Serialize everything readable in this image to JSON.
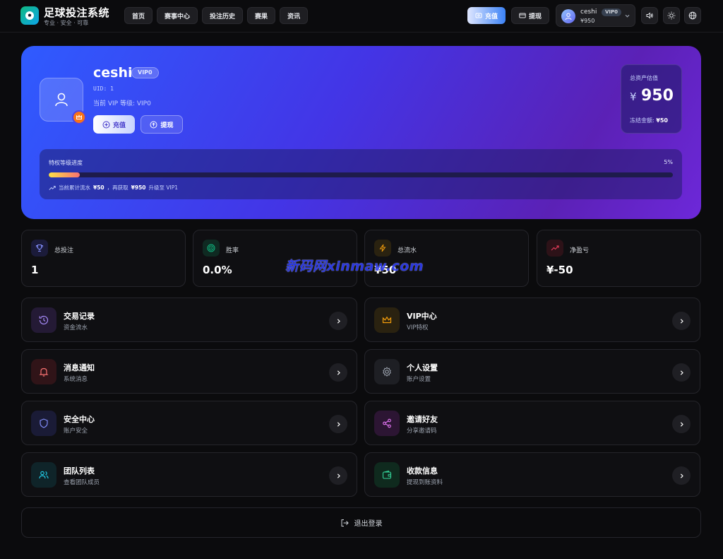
{
  "brand": {
    "title": "足球投注系统",
    "subtitle": "专业 · 安全 · 可靠"
  },
  "nav": {
    "items": [
      "首页",
      "赛事中心",
      "投注历史",
      "赛果",
      "资讯"
    ]
  },
  "top_actions": {
    "recharge": "充值",
    "withdraw": "提现"
  },
  "user_chip": {
    "name": "ceshi",
    "vip": "VIP0",
    "balance": "¥950"
  },
  "hero": {
    "name": "ceshi",
    "vip_badge": "VIP0",
    "uid": "UID: 1",
    "level": "当前 VIP 等级: VIP0",
    "recharge": "充值",
    "withdraw": "提现",
    "asset_label": "总资产估值",
    "asset_currency": "¥",
    "asset_value": "950",
    "frozen_label": "冻结金额:",
    "frozen_value": "¥50",
    "progress_title": "特权等级进度",
    "progress_pct_text": "5%",
    "progress_value": 5,
    "note_prefix": "当前累计流水",
    "note_flow": "¥50",
    "note_mid": "，再获取",
    "note_need": "¥950",
    "note_suffix": "升级至 VIP1"
  },
  "stats": [
    {
      "label": "总投注",
      "value": "1"
    },
    {
      "label": "胜率",
      "value": "0.0%"
    },
    {
      "label": "总流水",
      "value": "¥50"
    },
    {
      "label": "净盈亏",
      "value": "¥-50"
    }
  ],
  "menu": [
    {
      "title": "交易记录",
      "subtitle": "资金流水"
    },
    {
      "title": "VIP中心",
      "subtitle": "VIP特权"
    },
    {
      "title": "消息通知",
      "subtitle": "系统消息"
    },
    {
      "title": "个人设置",
      "subtitle": "账户设置"
    },
    {
      "title": "安全中心",
      "subtitle": "账户安全"
    },
    {
      "title": "邀请好友",
      "subtitle": "分享邀请码"
    },
    {
      "title": "团队列表",
      "subtitle": "查看团队成员"
    },
    {
      "title": "收款信息",
      "subtitle": "提现到账资料"
    }
  ],
  "logout": "退出登录",
  "watermark": "新码网xinmaw.com",
  "colors": {
    "background": "#0b0b0d",
    "card": "#0f0f12",
    "hero_start": "#2f5bff",
    "hero_end": "#6d28d9",
    "accent_orange": "#f97316"
  },
  "icons": {
    "logo": "soccer-ball-icon",
    "volume": "volume-icon",
    "theme": "sun-icon",
    "language": "globe-icon",
    "avatar": "user-icon",
    "crown": "crown-icon"
  }
}
